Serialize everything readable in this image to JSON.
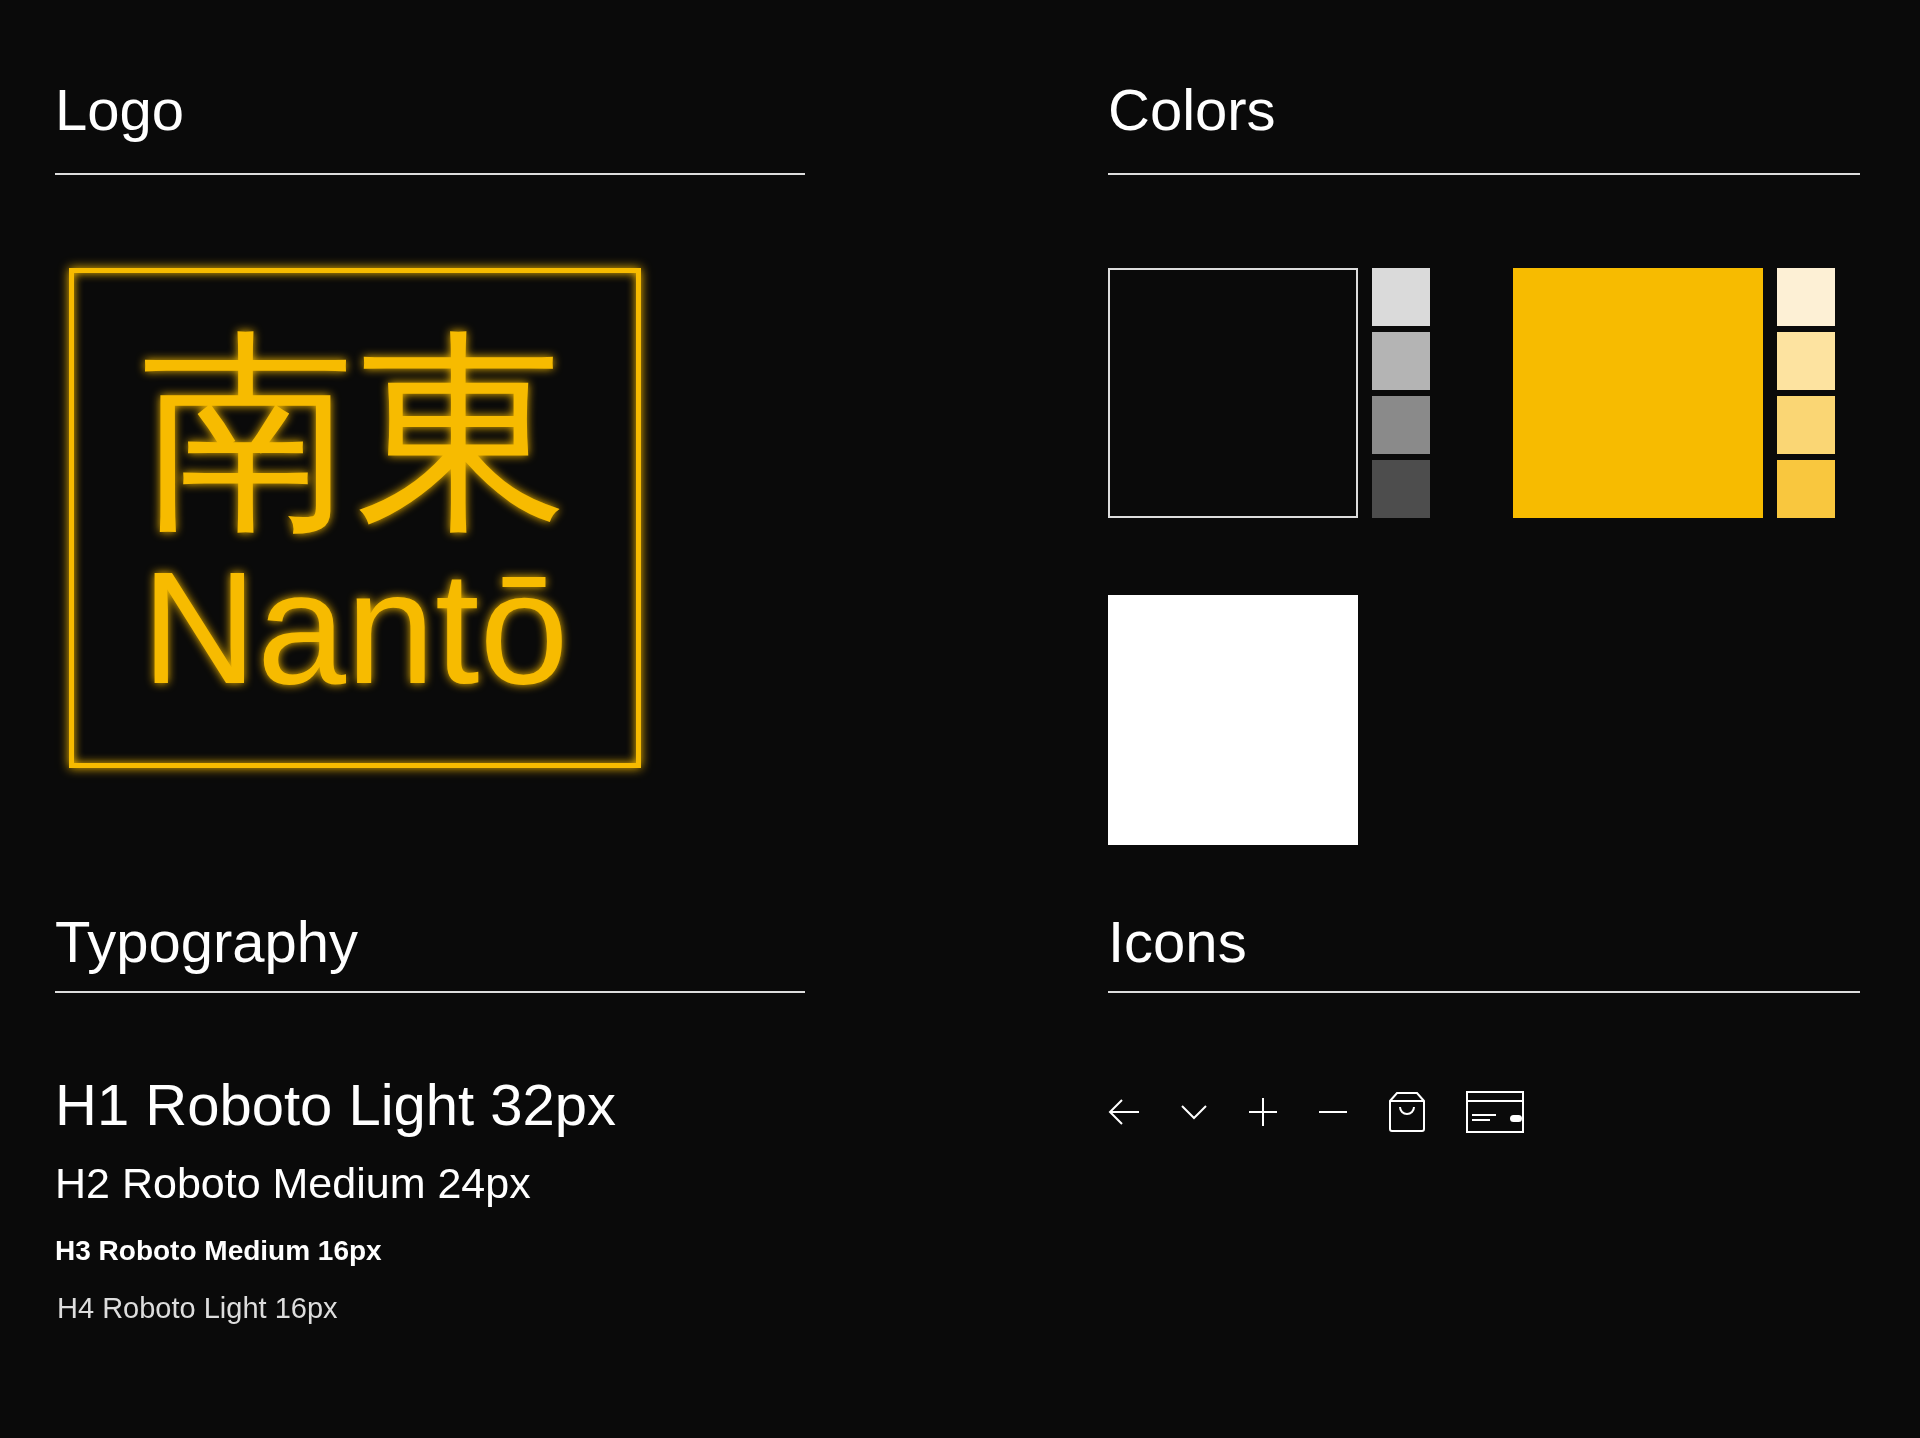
{
  "logo": {
    "title": "Logo",
    "mark": {
      "kanji": "南東",
      "romaji": "Nantō",
      "color": "#f7bb00"
    }
  },
  "colors": {
    "title": "Colors",
    "palettes": [
      {
        "color": "#0a0a0a",
        "outlined": true,
        "shades": [
          {
            "color": "#dadada"
          },
          {
            "color": "#b4b4b4"
          },
          {
            "color": "#8a8a8a"
          },
          {
            "color": "#4d4d4d"
          }
        ]
      },
      {
        "color": "#f7bb00",
        "outlined": false,
        "shades": [
          {
            "color": "#fdf0d5"
          },
          {
            "color": "#fde3a0"
          },
          {
            "color": "#fad674"
          },
          {
            "color": "#f9c73e"
          }
        ]
      },
      {
        "color": "#ffffff",
        "outlined": false
      }
    ]
  },
  "typography": {
    "title": "Typography",
    "samples": [
      {
        "kind": "h1",
        "text": "H1 Roboto Light 32px"
      },
      {
        "kind": "h2",
        "text": "H2 Roboto Medium 24px"
      },
      {
        "kind": "h3",
        "text": "H3 Roboto Medium 16px"
      },
      {
        "kind": "h4",
        "text": "H4 Roboto Light 16px"
      }
    ]
  },
  "icons": {
    "title": "Icons"
  }
}
